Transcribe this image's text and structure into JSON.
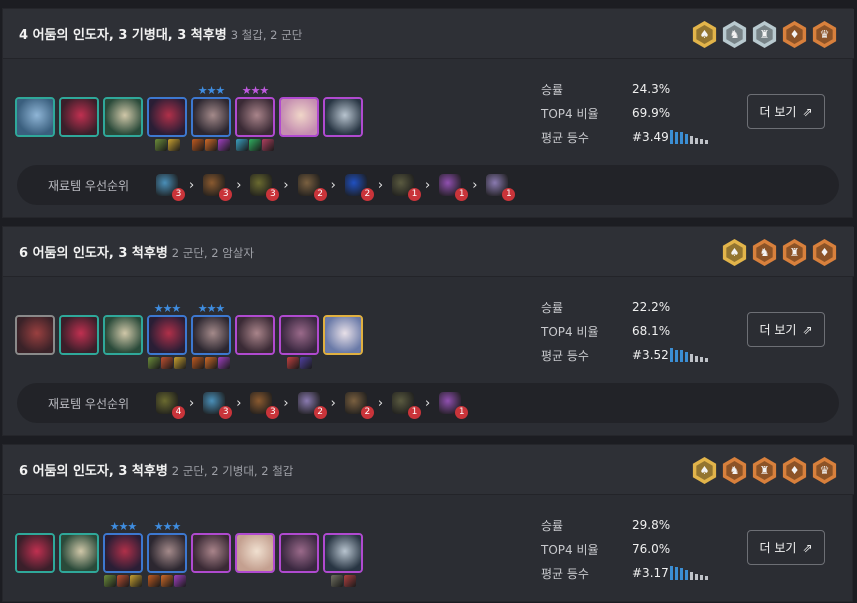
{
  "stat_labels": {
    "winrate": "승률",
    "top4": "TOP4 비율",
    "avg": "평균 등수"
  },
  "more_label": "더 보기",
  "priority_label": "재료템 우선순위",
  "comps": [
    {
      "title": "4 어둠의 인도자, 3 기병대, 3 척후병",
      "subtitle": "3 철갑, 2 군단",
      "traits": [
        "gold",
        "silver",
        "silver",
        "bronze",
        "bronze"
      ],
      "winrate": "24.3%",
      "top4": "69.9%",
      "avg": "#3.49",
      "rank_heights": [
        14,
        12,
        12,
        10,
        8,
        6,
        5,
        4
      ],
      "units": [
        {
          "border": "#2fa89a",
          "colors": [
            "#3a5f7e",
            "#8fb5d6"
          ],
          "stars": "",
          "items": []
        },
        {
          "border": "#2fa89a",
          "colors": [
            "#3a1f2a",
            "#c03050"
          ],
          "stars": "",
          "items": []
        },
        {
          "border": "#2fa89a",
          "colors": [
            "#2a4a3a",
            "#d0c7a8"
          ],
          "stars": "",
          "items": []
        },
        {
          "border": "#3d78d0",
          "colors": [
            "#2a1e35",
            "#b03049"
          ],
          "stars": "",
          "items": [
            "#6b8c3a",
            "#c8a030"
          ]
        },
        {
          "border": "#3d78d0",
          "colors": [
            "#2c2730",
            "#a48a8a"
          ],
          "stars": "★★★",
          "star_color": "blue",
          "items": [
            "#c05a20",
            "#d06a28",
            "#a040c0"
          ]
        },
        {
          "border": "#b04ad0",
          "colors": [
            "#3a2a35",
            "#a9848a"
          ],
          "stars": "★★★",
          "star_color": "purple",
          "items": [
            "#3aa0c0",
            "#30b060",
            "#b04060"
          ]
        },
        {
          "border": "#b04ad0",
          "colors": [
            "#c48db0",
            "#f0d6c8"
          ],
          "stars": "",
          "items": []
        },
        {
          "border": "#b04ad0",
          "colors": [
            "#283543",
            "#b8c4cf"
          ],
          "stars": "",
          "items": []
        }
      ],
      "priority": [
        {
          "color": "#4a8fb8",
          "count": "3"
        },
        {
          "color": "#8a5a30",
          "count": "3"
        },
        {
          "color": "#6a6a30",
          "count": "3"
        },
        {
          "color": "#7a6040",
          "count": "2"
        },
        {
          "color": "#2050c0",
          "count": "2"
        },
        {
          "color": "#5a5a40",
          "count": "1"
        },
        {
          "color": "#9050b0",
          "count": "1"
        },
        {
          "color": "#8a7ab0",
          "count": "1"
        }
      ]
    },
    {
      "title": "6 어둠의 인도자, 3 척후병",
      "subtitle": "2 군단, 2 암살자",
      "traits": [
        "gold",
        "bronze",
        "bronze",
        "bronze"
      ],
      "winrate": "22.2%",
      "top4": "68.1%",
      "avg": "#3.52",
      "rank_heights": [
        14,
        12,
        12,
        10,
        8,
        6,
        5,
        4
      ],
      "units": [
        {
          "border": "#8a8a8a",
          "colors": [
            "#3a2228",
            "#9a4040"
          ],
          "stars": "",
          "items": []
        },
        {
          "border": "#2fa89a",
          "colors": [
            "#3a1f2a",
            "#c03050"
          ],
          "stars": "",
          "items": []
        },
        {
          "border": "#2fa89a",
          "colors": [
            "#2a4a3a",
            "#d0c7a8"
          ],
          "stars": "",
          "items": []
        },
        {
          "border": "#3d78d0",
          "colors": [
            "#2a1e35",
            "#b03049"
          ],
          "stars": "★★★",
          "star_color": "blue",
          "items": [
            "#6b8c3a",
            "#c05030",
            "#c8a030"
          ]
        },
        {
          "border": "#3d78d0",
          "colors": [
            "#2c2730",
            "#a48a8a"
          ],
          "stars": "★★★",
          "star_color": "blue",
          "items": [
            "#c05a20",
            "#d06a28",
            "#a040c0"
          ]
        },
        {
          "border": "#b04ad0",
          "colors": [
            "#3a2a35",
            "#a9848a"
          ],
          "stars": "",
          "items": []
        },
        {
          "border": "#b04ad0",
          "colors": [
            "#3a2840",
            "#9a6a8a"
          ],
          "stars": "",
          "items": [
            "#c04040",
            "#5040a0"
          ]
        },
        {
          "border": "#e0b040",
          "colors": [
            "#6a7aa8",
            "#e8e0e8"
          ],
          "stars": "",
          "items": []
        }
      ],
      "priority": [
        {
          "color": "#6a6a30",
          "count": "4"
        },
        {
          "color": "#4a8fb8",
          "count": "3"
        },
        {
          "color": "#8a5a30",
          "count": "3"
        },
        {
          "color": "#8a7ab0",
          "count": "2"
        },
        {
          "color": "#7a6040",
          "count": "2"
        },
        {
          "color": "#5a5a40",
          "count": "1"
        },
        {
          "color": "#9050b0",
          "count": "1"
        }
      ]
    },
    {
      "title": "6 어둠의 인도자, 3 척후병",
      "subtitle": "2 군단, 2 기병대, 2 철갑",
      "traits": [
        "gold",
        "bronze",
        "bronze",
        "bronze",
        "bronze"
      ],
      "winrate": "29.8%",
      "top4": "76.0%",
      "avg": "#3.17",
      "rank_heights": [
        14,
        13,
        12,
        10,
        8,
        6,
        5,
        4
      ],
      "units": [
        {
          "border": "#2fa89a",
          "colors": [
            "#3a1f2a",
            "#c03050"
          ],
          "stars": "",
          "items": []
        },
        {
          "border": "#2fa89a",
          "colors": [
            "#2a4a3a",
            "#d0c7a8"
          ],
          "stars": "",
          "items": []
        },
        {
          "border": "#3d78d0",
          "colors": [
            "#2a1e35",
            "#b03049"
          ],
          "stars": "★★★",
          "star_color": "blue",
          "items": [
            "#6b8c3a",
            "#c05030",
            "#c8a030"
          ]
        },
        {
          "border": "#3d78d0",
          "colors": [
            "#2c2730",
            "#a48a8a"
          ],
          "stars": "★★★",
          "star_color": "blue",
          "items": [
            "#c05a20",
            "#d06a28",
            "#a040c0"
          ]
        },
        {
          "border": "#b04ad0",
          "colors": [
            "#3a2a35",
            "#a9848a"
          ],
          "stars": "",
          "items": []
        },
        {
          "border": "#b04ad0",
          "colors": [
            "#c4a090",
            "#f0e0d0"
          ],
          "stars": "",
          "items": []
        },
        {
          "border": "#b04ad0",
          "colors": [
            "#3a2840",
            "#9a6a8a"
          ],
          "stars": "",
          "items": []
        },
        {
          "border": "#b04ad0",
          "colors": [
            "#283543",
            "#b8c4cf"
          ],
          "stars": "",
          "items": [
            "#707060",
            "#b04040"
          ]
        }
      ],
      "priority": []
    }
  ],
  "trait_icons": [
    "♠",
    "♞",
    "♜",
    "♦",
    "♛"
  ]
}
